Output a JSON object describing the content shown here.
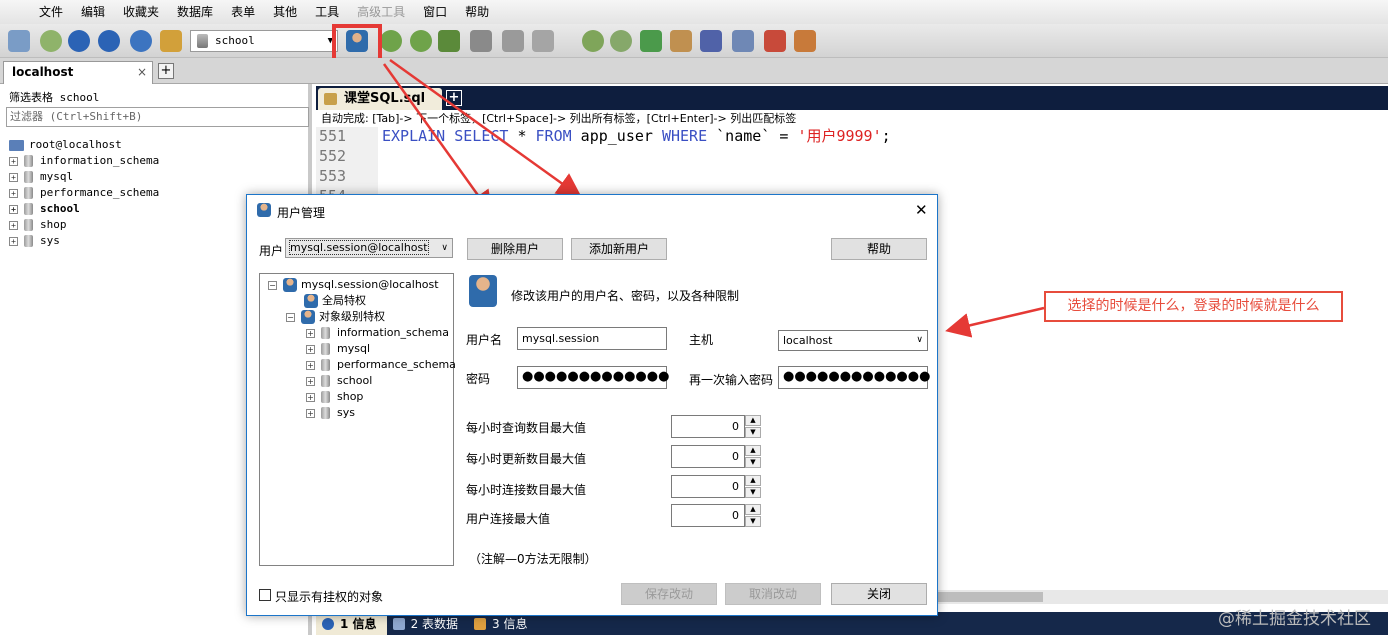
{
  "menu": [
    "文件",
    "编辑",
    "收藏夹",
    "数据库",
    "表单",
    "其他",
    "工具",
    "高级工具",
    "窗口",
    "帮助"
  ],
  "toolbar": {
    "db_select": "school"
  },
  "connection_tab": {
    "label": "localhost",
    "close": "×",
    "add": "+"
  },
  "left_panel": {
    "filter_label": "筛选表格 school",
    "filter_placeholder": "过滤器 (Ctrl+Shift+B)",
    "root": "root@localhost",
    "databases": [
      "information_schema",
      "mysql",
      "performance_schema",
      "school",
      "shop",
      "sys"
    ],
    "selected": "school"
  },
  "editor": {
    "tab": "课堂SQL.sql",
    "add_tab": "+",
    "autocomplete_hint": "自动完成:  [Tab]-> 下一个标签，[Ctrl+Space]-> 列出所有标签，[Ctrl+Enter]-> 列出匹配标签",
    "line_numbers": [
      "551",
      "552",
      "553",
      "554"
    ],
    "code_tokens": {
      "kw1": "EXPLAIN",
      "kw2": "SELECT",
      "star": " * ",
      "kw3": "FROM",
      "table": " app_user ",
      "kw4": "WHERE",
      "cond": " `name` = ",
      "str": "'用户9999'",
      "end": ";"
    }
  },
  "bottom_tabs": [
    {
      "num": "1",
      "label": "信息"
    },
    {
      "num": "2",
      "label": "表数据"
    },
    {
      "num": "3",
      "label": "信息"
    }
  ],
  "watermark": "@稀土掘金技术社区",
  "dialog": {
    "title": "用户管理",
    "close": "✕",
    "user_label": "用户",
    "user_value": "mysql.session@localhost",
    "delete_btn": "删除用户",
    "add_btn": "添加新用户",
    "help_btn": "帮助",
    "tree": {
      "user": "mysql.session@localhost",
      "global": "全局特权",
      "object": "对象级别特权",
      "dbs": [
        "information_schema",
        "mysql",
        "performance_schema",
        "school",
        "shop",
        "sys"
      ]
    },
    "desc": "修改该用户的用户名、密码，以及各种限制",
    "username_label": "用户名",
    "username_value": "mysql.session",
    "host_label": "主机",
    "host_value": "localhost",
    "password_label": "密码",
    "password_value": "●●●●●●●●●●●●●",
    "repassword_label": "再一次输入密码",
    "repassword_value": "●●●●●●●●●●●●●",
    "limits": [
      {
        "label": "每小时查询数目最大值",
        "value": "0"
      },
      {
        "label": "每小时更新数目最大值",
        "value": "0"
      },
      {
        "label": "每小时连接数目最大值",
        "value": "0"
      },
      {
        "label": "用户连接最大值",
        "value": "0"
      }
    ],
    "note": "（注解—0方法无限制）",
    "only_privileged": "只显示有挂权的对象",
    "save_btn": "保存改动",
    "cancel_btn": "取消改动",
    "close_btn": "关闭"
  },
  "annotation": "选择的时候是什么，登录的时候就是什么",
  "colors": {
    "accent_red": "#e53935",
    "editor_bar": "#0e1e3e",
    "keyword": "#3a4fc3",
    "string": "#dd2222"
  }
}
